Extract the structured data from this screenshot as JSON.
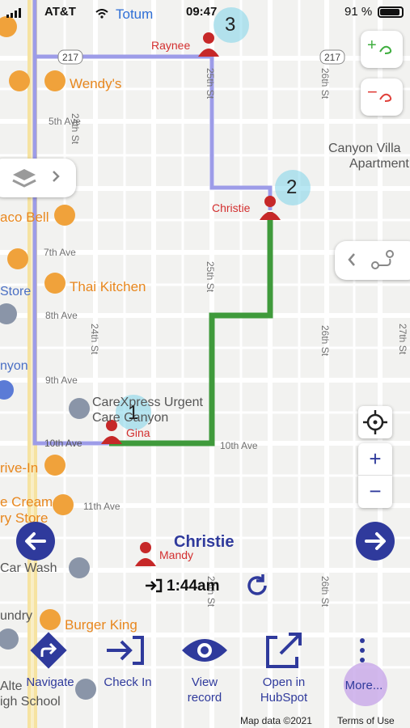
{
  "status_bar": {
    "carrier": "AT&T",
    "time": "09:47",
    "battery": "91 %"
  },
  "map": {
    "place_totum": "Totum",
    "streets": {
      "s5": "5th Ave",
      "s7": "7th Ave",
      "s8": "8th Ave",
      "s9": "9th Ave",
      "s10a": "10th Ave",
      "s10b": "10th Ave",
      "s11": "11th Ave",
      "r217a": "217",
      "r217b": "217",
      "st24a": "24th St",
      "st24b": "24th St",
      "st25a": "25th St",
      "st25b": "25th St",
      "st25c": "25th St",
      "st26a": "26th St",
      "st26b": "26th St",
      "st26c": "26th St",
      "st27": "27th St"
    },
    "pois": {
      "wendys": "Wendy's",
      "thai": "Thai Kitchen",
      "taco": "aco Bell",
      "store": "Store",
      "nyon": "nyon",
      "driveins": "rive-In",
      "icecream": "e Cream",
      "rystore": "ry Store",
      "carwash": "Car Wash",
      "undry": "undry",
      "burger": "Burger King",
      "alte": "Alte",
      "school": "igh School",
      "canyon1": "Canyon Villa",
      "canyon2": "Apartment",
      "carex1": "CareXpress Urgent",
      "carex2": "Care Canyon"
    },
    "markers": [
      {
        "num": "1"
      },
      {
        "num": "2"
      },
      {
        "num": "3"
      }
    ],
    "people": {
      "raynee": "Raynee",
      "christie": "Christie",
      "gina": "Gina",
      "mandy": "Mandy"
    },
    "footer": {
      "data": "Map data ©2021",
      "terms": "Terms of Use"
    }
  },
  "controls": {
    "zoom_in": "+",
    "zoom_out": "−"
  },
  "panel": {
    "name": "Christie",
    "time": "1:44am"
  },
  "actions": {
    "navigate": "Navigate",
    "checkin": "Check In",
    "view1": "View",
    "view2": "record",
    "open1": "Open in",
    "open2": "HubSpot",
    "more": "More..."
  },
  "colors": {
    "route_done": "#9d9ce8",
    "route_active": "#3f9a3b",
    "accent": "#2f3a9c",
    "marker": "#d32f2f"
  }
}
